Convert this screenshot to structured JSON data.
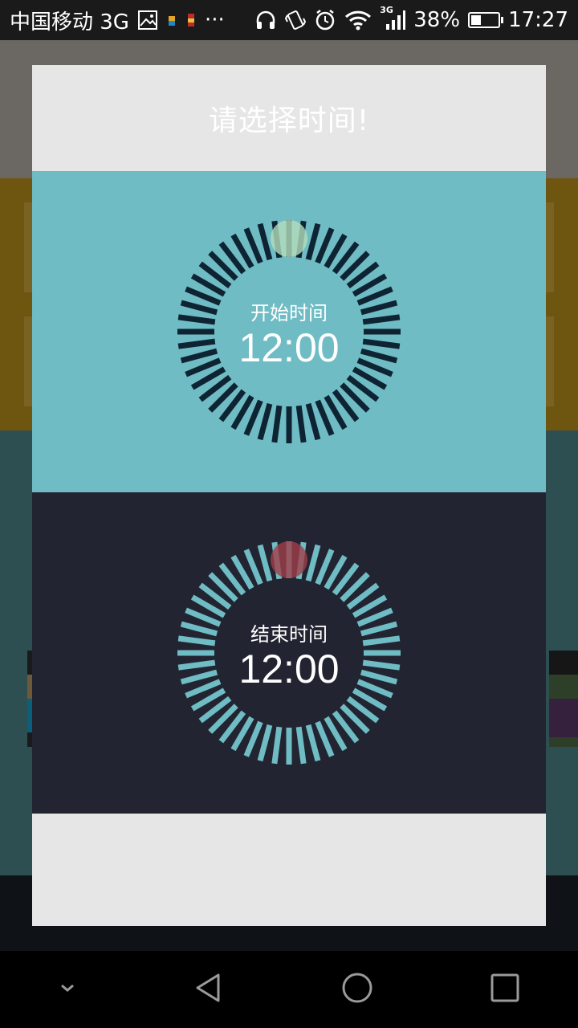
{
  "status_bar": {
    "carrier": "中国移动 3G",
    "overflow": "···",
    "network": "3G",
    "battery_percent": "38%",
    "battery_level": 0.38,
    "time": "17:27",
    "icons": [
      "image-icon",
      "app-icon",
      "app-icon",
      "headphones-icon",
      "vibrate-icon",
      "alarm-icon",
      "wifi-icon",
      "signal-icon",
      "battery-icon"
    ]
  },
  "dialog": {
    "title": "请选择时间!",
    "start": {
      "label": "开始时间",
      "time": "12:00",
      "panel_color": "#6fbcc4",
      "tick_color": "#0e2433",
      "handle_color": "#b4dcbc"
    },
    "end": {
      "label": "结束时间",
      "time": "12:00",
      "panel_color": "#222531",
      "tick_color": "#6fbcc4",
      "handle_color": "#a03e4a"
    }
  },
  "nav_bar": {
    "icons": [
      "chevron-down-icon",
      "back-icon",
      "home-icon",
      "recents-icon"
    ]
  },
  "colors": {
    "dialog_bg": "#e6e6e6",
    "scrim": "rgba(0,0,0,0.6)"
  }
}
